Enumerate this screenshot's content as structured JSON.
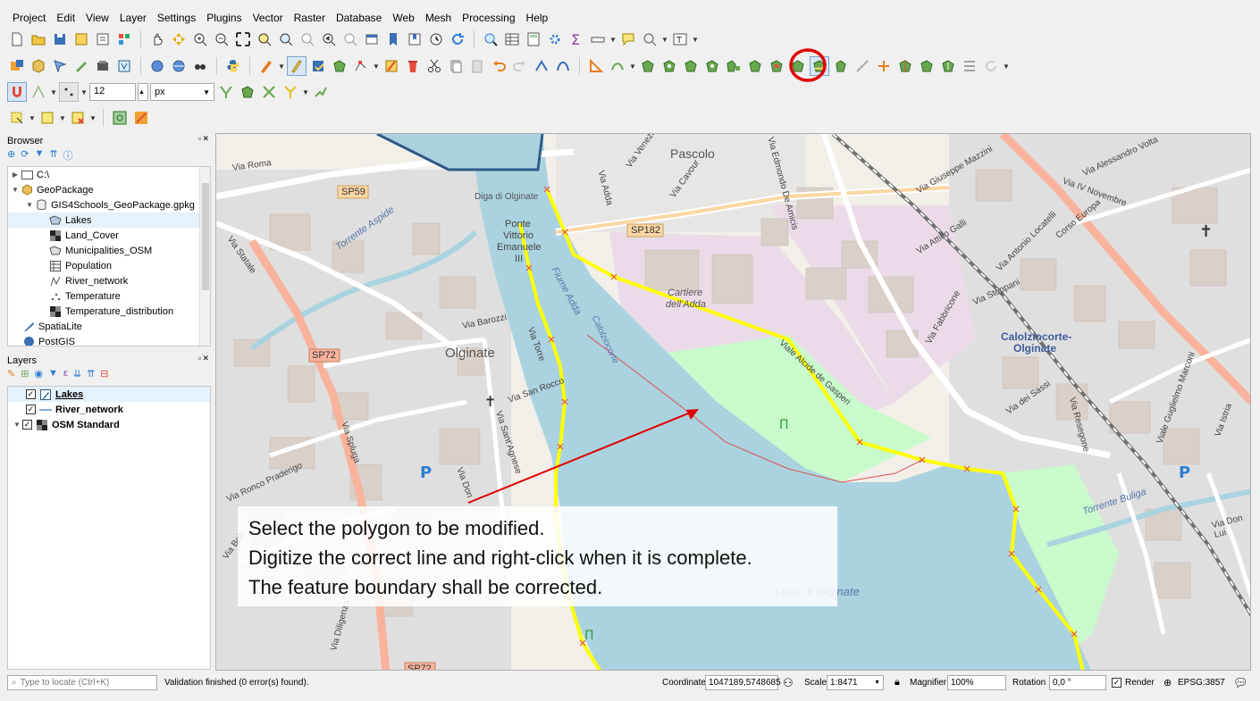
{
  "menu": [
    "Project",
    "Edit",
    "View",
    "Layer",
    "Settings",
    "Plugins",
    "Vector",
    "Raster",
    "Database",
    "Web",
    "Mesh",
    "Processing",
    "Help"
  ],
  "snapping": {
    "tolerance": "12",
    "unit": "px"
  },
  "browser": {
    "title": "Browser",
    "items": [
      {
        "label": "C:\\",
        "icon": "folder-icon"
      },
      {
        "label": "GeoPackage",
        "icon": "geopackage-icon"
      },
      {
        "label": "GIS4Schools_GeoPackage.gpkg",
        "icon": "database-icon"
      },
      {
        "label": "Lakes",
        "icon": "polygon-layer-icon"
      },
      {
        "label": "Land_Cover",
        "icon": "raster-layer-icon"
      },
      {
        "label": "Municipalities_OSM",
        "icon": "polygon-layer-icon"
      },
      {
        "label": "Population",
        "icon": "table-icon"
      },
      {
        "label": "River_network",
        "icon": "line-layer-icon"
      },
      {
        "label": "Temperature",
        "icon": "point-layer-icon"
      },
      {
        "label": "Temperature_distribution",
        "icon": "raster-layer-icon"
      },
      {
        "label": "SpatiaLite",
        "icon": "spatialite-icon"
      },
      {
        "label": "PostGIS",
        "icon": "postgis-icon"
      }
    ]
  },
  "layers": {
    "title": "Layers",
    "items": [
      {
        "label": "Lakes",
        "checked": true,
        "icon": "editing-pencil-icon"
      },
      {
        "label": "River_network",
        "checked": true,
        "icon": "line-symbol-icon"
      },
      {
        "label": "OSM Standard",
        "checked": true,
        "icon": "raster-layer-icon"
      }
    ]
  },
  "map": {
    "labels": {
      "pascolo": "Pascolo",
      "olginate": "Olginate",
      "calolziocorte": "Calolziocorte-",
      "calolziocorte2": "Olginate",
      "lago": "Lago di Olginate",
      "diga": "Diga di Olginate",
      "ponte1": "Ponte",
      "ponte2": "Vittorio",
      "ponte3": "Emanuele",
      "ponte4": "III",
      "cartiere": "Cartiere",
      "cartiere2": "dell'Adda",
      "fiume": "Fiume Adda",
      "calolzio_river": "Calolziocorte",
      "sp59": "SP59",
      "sp182": "SP182",
      "sp72": "SP72",
      "sp72b": "SP72",
      "via_roma": "Via Roma",
      "via_statale": "Via Statale",
      "via_spluga": "Via Spluga",
      "torrente_aspide": "Torrente Aspide",
      "corso_europa": "Corso Europa",
      "via_barozzi": "Via Barozzi",
      "via_san_rocco": "Via San Rocco",
      "viale_de_gasperi": "Viale Alcide de Gasperi",
      "torrente_bulaga": "Torrente Buliga",
      "via_resegone": "Via Resegone",
      "via_dei_sassi": "Via dei Sassi",
      "via_ronco": "Via Ronco Praderigo",
      "via_venezia": "Via Venezia",
      "via_cavour": "Via Cavour",
      "via_adda": "Via Adda",
      "via_stoppani": "Via Stoppani",
      "via_attilio_galli": "Via Attilio Galli",
      "via_locatelli": "Via Antonio Locatelli",
      "via_mazzini": "Via Giuseppe Mazzini",
      "via_iv_novembre": "Via IV Novembre",
      "via_de_amicis": "Via Edmondo De Amicis",
      "via_fabbricone": "Via Fabbricone",
      "via_marconi": "Viale Guglielmo Marconi",
      "via_istria": "Via Istria",
      "via_volta": "Via Alessandro Volta",
      "via_torre": "Via Torre",
      "via_sant_agnese": "Via Sant'Agnese",
      "via_don": "Via Don",
      "via_diligenza": "Via Diligenza",
      "via_belvedere": "Via Belv",
      "via_don_luigi": "Via Don Lui"
    }
  },
  "instruction": {
    "line1": "Select the polygon to be modified.",
    "line2": "Digitize the correct line and right-click when it is complete.",
    "line3": "The feature boundary shall be corrected."
  },
  "status": {
    "locate_placeholder": "Type to locate (Ctrl+K)",
    "message": "Validation finished (0 error(s) found).",
    "coordinate_label": "Coordinate",
    "coordinate": "1047189,5748685",
    "scale_label": "Scale",
    "scale": "1:8471",
    "magnifier_label": "Magnifier",
    "magnifier": "100%",
    "rotation_label": "Rotation",
    "rotation": "0,0 °",
    "render_label": "Render",
    "crs": "EPSG:3857"
  },
  "colors": {
    "water": "#aad3df",
    "park": "#c8facc",
    "building": "#d9d0c9",
    "residential": "#e0dfdf",
    "industrial": "#ebdbe8",
    "trunk": "#f9b29c",
    "digitize_line": "#ffff00",
    "highlight_circle": "#e00000",
    "arrow": "#e00000"
  }
}
